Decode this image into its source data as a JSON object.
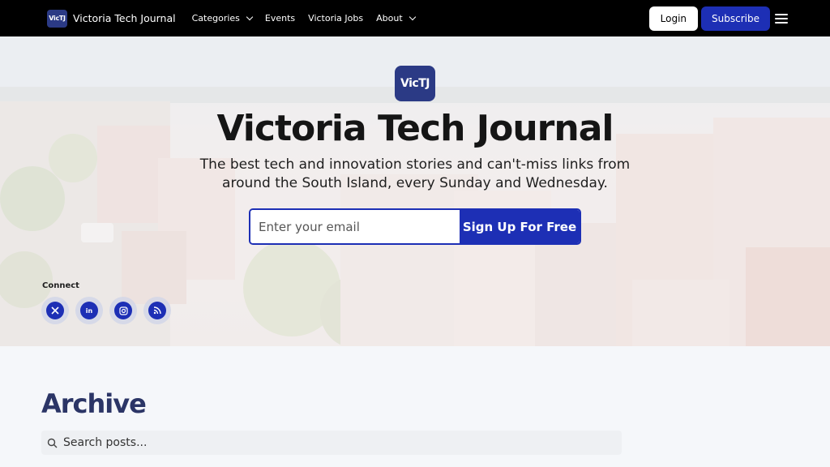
{
  "navbar": {
    "logo_text": "VicTJ",
    "brand_name": "Victoria Tech Journal",
    "links": [
      {
        "label": "Categories",
        "has_dropdown": true
      },
      {
        "label": "Events",
        "has_dropdown": false
      },
      {
        "label": "Victoria Jobs",
        "has_dropdown": false
      },
      {
        "label": "About",
        "has_dropdown": true
      }
    ],
    "login_label": "Login",
    "subscribe_label": "Subscribe",
    "menu_icon": "hamburger-icon"
  },
  "hero": {
    "logo_text": "VicTJ",
    "title": "Victoria Tech Journal",
    "subtitle": "The best tech and innovation stories and can't-miss links from around the South Island, every Sunday and Wednesday.",
    "email_placeholder": "Enter your email",
    "signup_label": "Sign Up For Free",
    "connect_label": "Connect",
    "socials": [
      {
        "icon": "x-icon",
        "glyph": "𝕏"
      },
      {
        "icon": "linkedin-icon",
        "glyph": "in"
      },
      {
        "icon": "instagram-icon",
        "glyph": ""
      },
      {
        "icon": "rss-icon",
        "glyph": ""
      }
    ]
  },
  "archive": {
    "title": "Archive",
    "search_placeholder": "Search posts..."
  },
  "colors": {
    "brand_blue": "#1d2fb5",
    "logo_navy": "#2b3a85",
    "navbar_bg": "#000000",
    "archive_title": "#2b3566"
  }
}
